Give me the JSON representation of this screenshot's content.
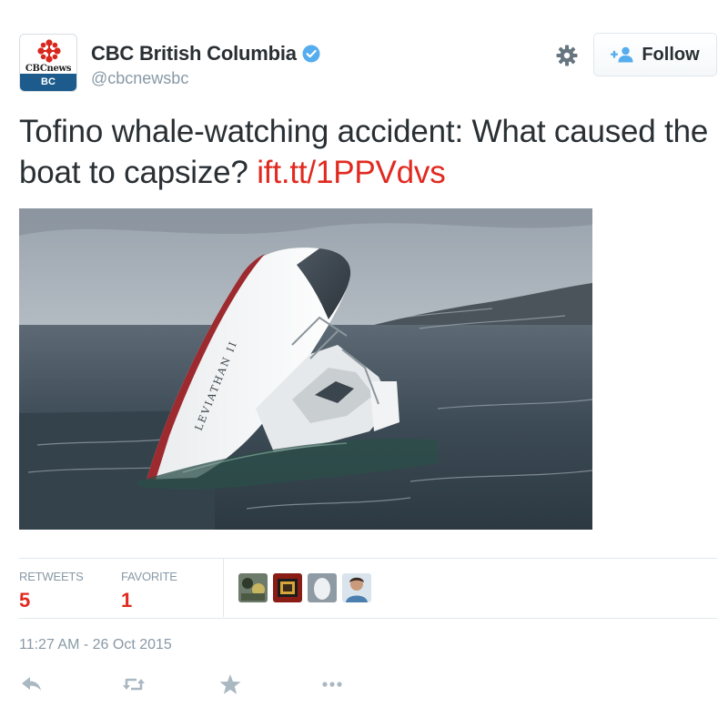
{
  "account": {
    "display_name": "CBC British Columbia",
    "handle": "@cbcnewsbc",
    "avatar_brand": "CBCnews",
    "avatar_region": "BC",
    "verified": true
  },
  "follow_button": {
    "label": "Follow"
  },
  "tweet": {
    "text": "Tofino whale-watching accident: What caused the boat to capsize?",
    "link": "ift.tt/1PPVdvs",
    "photo_caption_on_hull": "LEVIATHAN II"
  },
  "stats": {
    "retweets_label": "RETWEETS",
    "retweets_count": "5",
    "favorite_label": "FAVORITE",
    "favorite_count": "1"
  },
  "timestamp": "11:27 AM - 26 Oct 2015",
  "icons": {
    "verified": "verified-badge-icon",
    "settings": "gear-icon",
    "follow": "add-user-icon",
    "reply": "reply-icon",
    "retweet": "retweet-icon",
    "favorite": "star-icon",
    "more": "more-dots-icon"
  },
  "colors": {
    "link": "#e02a20",
    "count": "#e02a20",
    "verified": "#55acee",
    "muted": "#8899a6",
    "avatar_region_bg": "#1c5b8c"
  }
}
